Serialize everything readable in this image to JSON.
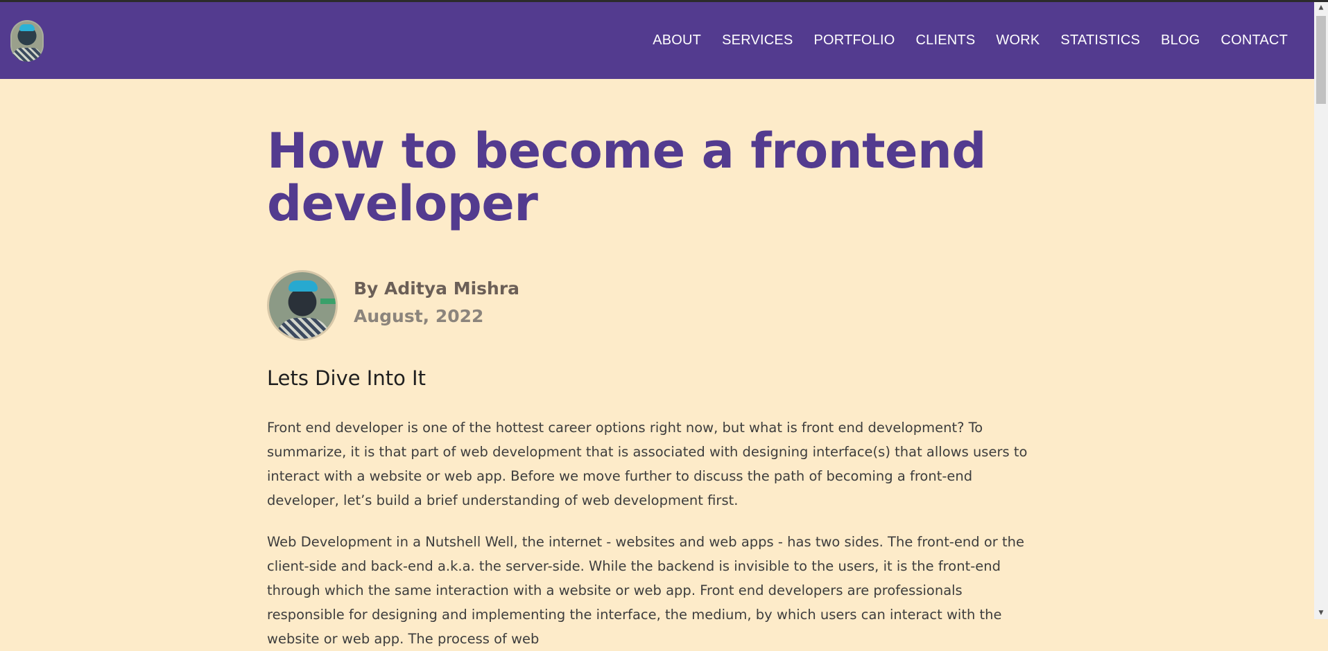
{
  "nav": {
    "logo_alt": "profile logo",
    "items": [
      {
        "label": "ABOUT"
      },
      {
        "label": "SERVICES"
      },
      {
        "label": "PORTFOLIO"
      },
      {
        "label": "CLIENTS"
      },
      {
        "label": "WORK"
      },
      {
        "label": "STATISTICS"
      },
      {
        "label": "BLOG"
      },
      {
        "label": "CONTACT"
      }
    ]
  },
  "post": {
    "title": "How to become a frontend developer",
    "author": "By Aditya Mishra",
    "date": "August, 2022",
    "section_heading": "Lets Dive Into It",
    "paragraphs": [
      "Front end developer is one of the hottest career options right now, but what is front end development? To summarize, it is that part of web development that is associated with designing interface(s) that allows users to interact with a website or web app. Before we move further to discuss the path of becoming a front-end developer, let’s build a brief understanding of web development first.",
      "Web Development in a Nutshell Well, the internet - websites and web apps - has two sides. The front-end or the client-side and back-end a.k.a. the server-side. While the backend is invisible to the users, it is the front-end through which the same interaction with a website or web app. Front end developers are professionals responsible for designing and implementing the interface, the medium, by which users can interact with the website or web app. The process of web"
    ]
  },
  "colors": {
    "navbar": "#533b8f",
    "background": "#fdebc9",
    "title": "#533b8f"
  }
}
